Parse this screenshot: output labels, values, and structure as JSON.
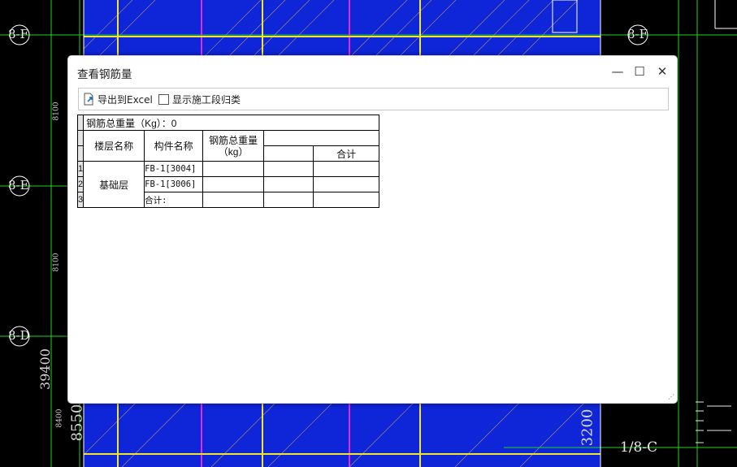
{
  "background": {
    "axis_labels": [
      "8-F",
      "8-F",
      "8-E",
      "8-D",
      "1/8-C"
    ],
    "dimension_labels": [
      "8100",
      "8100",
      "39400",
      "8400",
      "8550",
      "3200"
    ]
  },
  "dialog": {
    "title": "查看钢筋量",
    "controls": {
      "minimize": "—",
      "maximize": "☐",
      "close": "✕"
    }
  },
  "toolbar": {
    "export_label": "导出到Excel",
    "checkbox_label": "显示施工段归类",
    "checkbox_checked": false
  },
  "table": {
    "total_label": "钢筋总重量（Kg）：0",
    "headers": {
      "floor": "楼层名称",
      "component": "构件名称",
      "weight": "钢筋总重量（kg）",
      "sum": "合计"
    },
    "row_numbers": [
      "1",
      "2",
      "3"
    ],
    "floor_value": "基础层",
    "rows": [
      {
        "component": "FB-1[3004]",
        "weight": "",
        "col4": "",
        "sum": ""
      },
      {
        "component": "FB-1[3006]",
        "weight": "",
        "col4": "",
        "sum": ""
      },
      {
        "component": "合计:",
        "weight": "",
        "col4": "",
        "sum": ""
      }
    ]
  }
}
